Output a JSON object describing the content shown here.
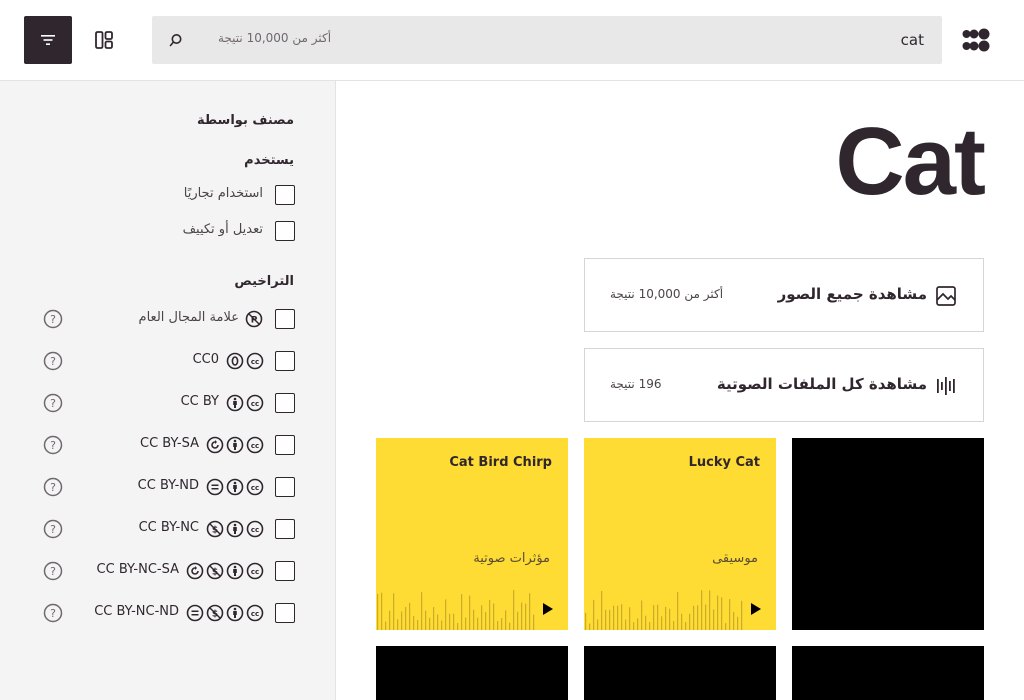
{
  "header": {
    "search_value": "cat",
    "search_count": "أكثر من 10,000 نتيجة",
    "icons": [
      "filter-icon",
      "layout-icon",
      "search-icon",
      "openverse-logo"
    ]
  },
  "sidebar": {
    "sort_title": "مصنف بواسطة",
    "use_title": "يستخدم",
    "use_items": [
      {
        "label": "استخدام تجاريًا"
      },
      {
        "label": "تعديل أو تكييف"
      }
    ],
    "license_title": "التراخيص",
    "license_items": [
      {
        "label": "علامة المجال العام"
      },
      {
        "label": "CC0"
      },
      {
        "label": "CC BY"
      },
      {
        "label": "CC BY-SA"
      },
      {
        "label": "CC BY-ND"
      },
      {
        "label": "CC BY-NC"
      },
      {
        "label": "CC BY-NC-SA"
      },
      {
        "label": "CC BY-NC-ND"
      }
    ]
  },
  "main": {
    "title": "Cat",
    "images_card": {
      "title": "مشاهدة جميع الصور",
      "count": "أكثر من 10,000 نتيجة"
    },
    "audio_card": {
      "title": "مشاهدة كل الملفات الصوتية",
      "count": "196 نتيجة"
    },
    "tiles": [
      {
        "title": "Cat Bird Chirp",
        "category": "مؤثرات صوتية"
      },
      {
        "title": "Lucky Cat",
        "category": "موسيقى"
      }
    ]
  },
  "colors": {
    "accent_dark": "#30272e",
    "audio_tile": "#fedc33",
    "sidebar_bg": "#f5f4f5",
    "search_bg": "#e9e8e9"
  }
}
